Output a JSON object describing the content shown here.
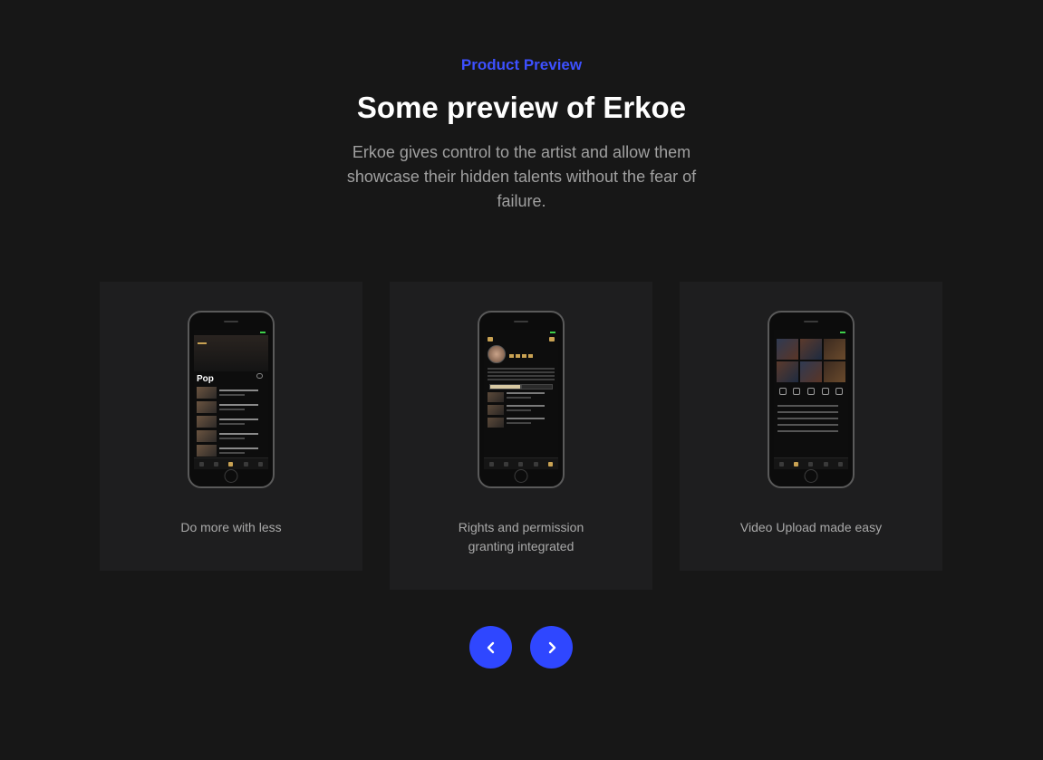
{
  "header": {
    "eyebrow": "Product Preview",
    "title": "Some preview of Erkoe",
    "subtitle": "Erkoe gives control to the artist and allow them showcase their hidden talents without the fear of failure."
  },
  "cards": [
    {
      "caption": "Do more with less",
      "screen_pop": "Pop"
    },
    {
      "caption": "Rights and permission granting integrated"
    },
    {
      "caption": "Video Upload made easy"
    }
  ],
  "navigation": {
    "prev_icon": "chevron-left-icon",
    "next_icon": "chevron-right-icon"
  },
  "colors": {
    "background": "#171717",
    "card": "#1e1e1f",
    "accent": "#2f47ff",
    "eyebrow": "#3d50ff",
    "gold": "#c9a253"
  }
}
